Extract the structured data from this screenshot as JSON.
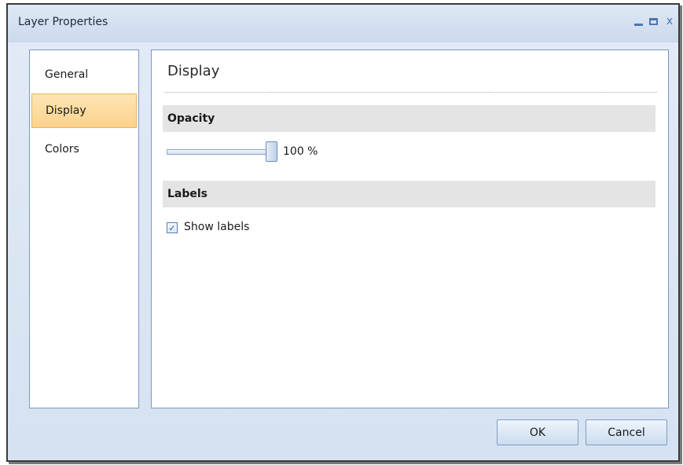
{
  "window": {
    "title": "Layer Properties",
    "controls": {
      "minimize_icon": "minimize-icon",
      "maximize_icon": "maximize-icon",
      "close_glyph": "x"
    }
  },
  "nav": {
    "items": [
      {
        "label": "General",
        "selected": false
      },
      {
        "label": "Display",
        "selected": true
      },
      {
        "label": "Colors",
        "selected": false
      }
    ]
  },
  "content": {
    "title": "Display",
    "opacity": {
      "header": "Opacity",
      "value_text": "100 %",
      "value_percent": 100
    },
    "labels": {
      "header": "Labels",
      "show_labels_text": "Show labels",
      "show_labels_checked": true,
      "check_glyph": "✓"
    }
  },
  "buttons": {
    "ok": "OK",
    "cancel": "Cancel"
  },
  "colors": {
    "selected_item_bg": "#fcd28c",
    "section_header_bg": "#e4e4e4",
    "window_bg": "#d6e2f1"
  }
}
